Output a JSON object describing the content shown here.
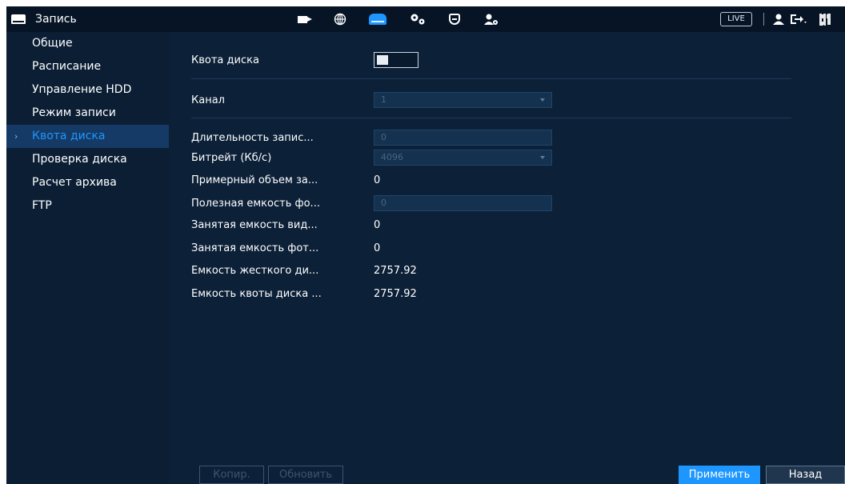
{
  "topbar": {
    "title": "Запись",
    "live_label": "LIVE",
    "icons": [
      "camera-icon",
      "globe-icon",
      "storage-icon",
      "gears-icon",
      "shield-icon",
      "account-settings-icon",
      "user-icon",
      "logout-icon",
      "qr-icon"
    ],
    "active_color": "#1e96ff"
  },
  "sidebar": {
    "items": [
      {
        "label": "Общие"
      },
      {
        "label": "Расписание"
      },
      {
        "label": "Управление HDD"
      },
      {
        "label": "Режим записи"
      },
      {
        "label": "Квота диска"
      },
      {
        "label": "Проверка диска"
      },
      {
        "label": "Расчет архива"
      },
      {
        "label": "FTP"
      }
    ],
    "active_chevron": "›"
  },
  "main": {
    "quota_label": "Квота диска",
    "channel_label": "Канал",
    "channel_value": "1",
    "duration_label": "Длительность запис...",
    "duration_value": "0",
    "bitrate_label": "Битрейт (Кб/с)",
    "bitrate_value": "4096",
    "approx_label": "Примерный объем за...",
    "approx_value": "0",
    "photo_useful_label": "Полезная емкость фо...",
    "photo_useful_value": "0",
    "video_used_label": "Занятая емкость вид...",
    "video_used_value": "0",
    "photo_used_label": "Занятая емкость фот...",
    "photo_used_value": "0",
    "hdd_capacity_label": "Емкость жесткого ди...",
    "hdd_capacity_value": "2757.92",
    "quota_capacity_label": "Емкость квоты диска ...",
    "quota_capacity_value": "2757.92"
  },
  "buttons": {
    "copy": "Копир.",
    "refresh": "Обновить",
    "apply": "Применить",
    "back": "Назад"
  }
}
